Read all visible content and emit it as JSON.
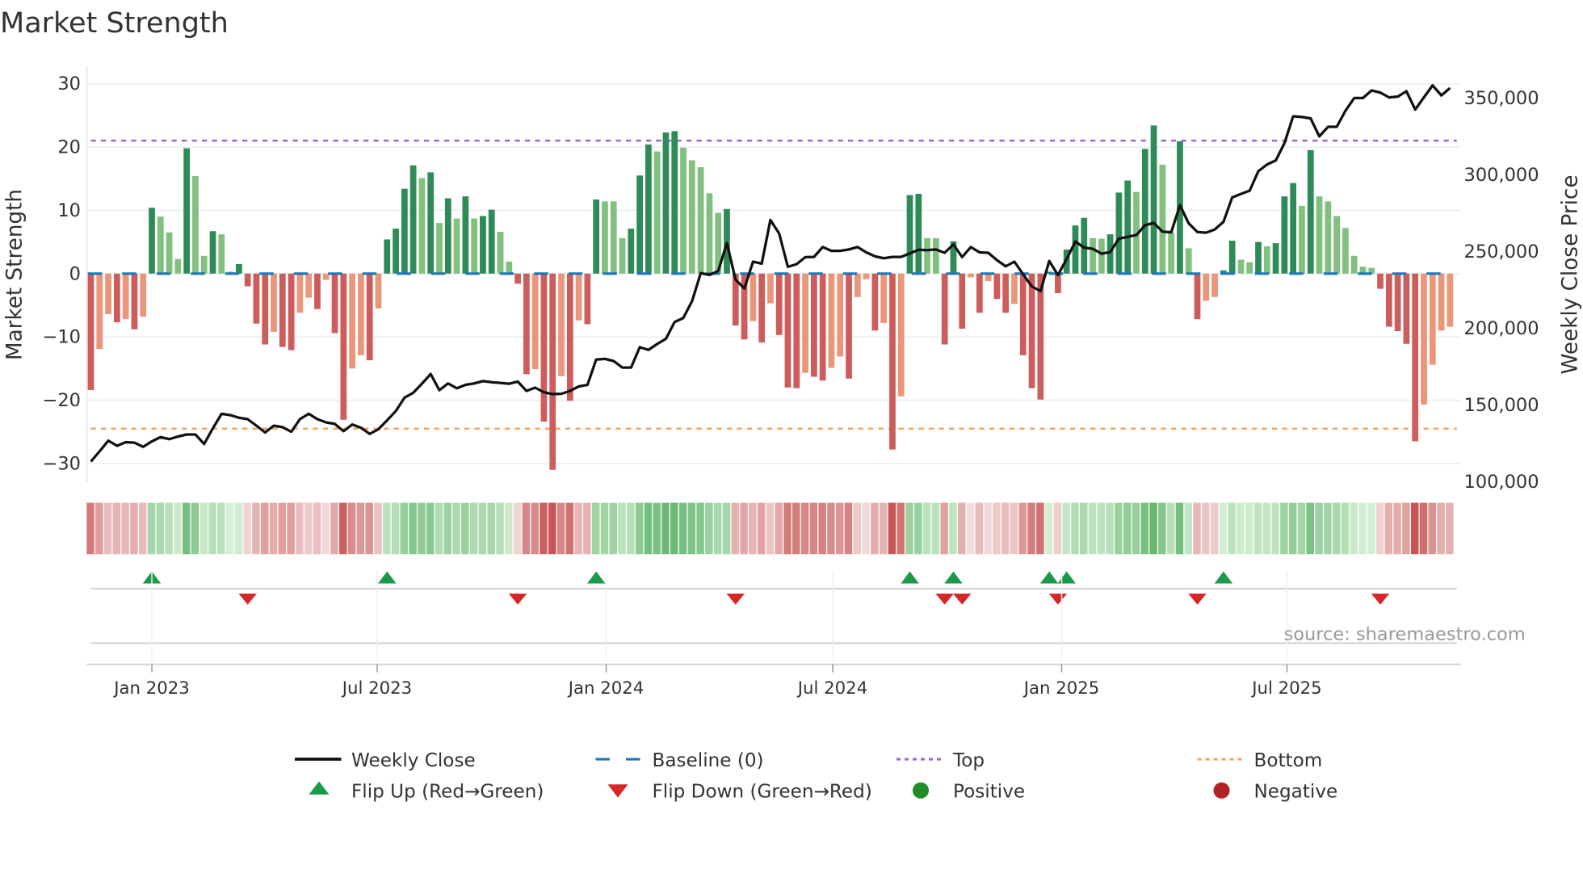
{
  "chart_data": {
    "type": "bar+line",
    "title": "Market Strength",
    "ylabel_left": "Market Strength",
    "ylabel_right": "Weekly Close Price",
    "ylim_left": [
      -33,
      31
    ],
    "ylim_right": [
      98000,
      362000
    ],
    "yticks_left": [
      30,
      20,
      10,
      0,
      -10,
      -20,
      -30
    ],
    "yticks_left_labels": [
      "30",
      "20",
      "10",
      "0",
      "−10",
      "−20",
      "−30"
    ],
    "yticks_right": [
      100000,
      150000,
      200000,
      250000,
      300000,
      350000
    ],
    "yticks_right_labels": [
      "100,000",
      "150,000",
      "200,000",
      "250,000",
      "300,000",
      "350,000"
    ],
    "xticks": [
      {
        "date": "2023-01-01",
        "label": "Jan 2023"
      },
      {
        "date": "2023-07-01",
        "label": "Jul 2023"
      },
      {
        "date": "2024-01-01",
        "label": "Jan 2024"
      },
      {
        "date": "2024-07-01",
        "label": "Jul 2024"
      },
      {
        "date": "2025-01-01",
        "label": "Jan 2025"
      },
      {
        "date": "2025-07-01",
        "label": "Jul 2025"
      }
    ],
    "start_date": "2022-11-13",
    "frequency": "weekly",
    "top_threshold": 21,
    "bottom_threshold": -24.5,
    "baseline": 0,
    "strength": [
      -18.4,
      -11.9,
      -6.4,
      -7.7,
      -7.2,
      -8.8,
      -6.8,
      10.4,
      9.0,
      6.5,
      2.3,
      19.8,
      15.4,
      2.8,
      6.7,
      6.2,
      0.3,
      1.5,
      -2.0,
      -7.9,
      -11.2,
      -9.2,
      -11.6,
      -12.1,
      -6.2,
      -3.8,
      -5.6,
      -1.0,
      -9.4,
      -23.1,
      -15.0,
      -12.9,
      -13.7,
      -5.5,
      5.4,
      7.1,
      13.4,
      17.1,
      15.1,
      16.0,
      8.0,
      11.9,
      8.7,
      12.2,
      8.7,
      9.1,
      10.1,
      6.6,
      1.9,
      -1.6,
      -15.9,
      -15.1,
      -23.4,
      -31.0,
      -16.2,
      -20.1,
      -7.4,
      -8.0,
      11.7,
      11.4,
      11.4,
      5.6,
      7.1,
      15.5,
      20.4,
      19.3,
      22.3,
      22.5,
      19.9,
      17.9,
      16.8,
      12.7,
      9.6,
      10.2,
      -8.2,
      -10.4,
      -7.5,
      -10.9,
      -4.7,
      -9.7,
      -18.0,
      -18.1,
      -15.7,
      -16.3,
      -16.9,
      -14.9,
      -13.1,
      -16.6,
      -3.7,
      -0.9,
      -9.0,
      -7.8,
      -27.8,
      -19.4,
      12.4,
      12.6,
      5.6,
      5.6,
      -11.2,
      5.1,
      -8.7,
      -0.6,
      -6.2,
      -1.2,
      -4.0,
      -6.2,
      -4.8,
      -12.9,
      -18.1,
      -19.9,
      0.3,
      -3.1,
      3.8,
      7.6,
      8.8,
      5.6,
      5.5,
      6.2,
      12.8,
      14.7,
      12.9,
      19.7,
      23.4,
      17.2,
      6.5,
      20.9,
      4.0,
      -7.2,
      -4.3,
      -3.7,
      0.5,
      5.2,
      2.2,
      1.8,
      5.0,
      4.3,
      4.8,
      12.2,
      14.3,
      10.7,
      19.5,
      12.2,
      11.4,
      9.1,
      7.2,
      2.8,
      1.1,
      0.9,
      -2.4,
      -8.4,
      -9.1,
      -11.1,
      -26.5,
      -20.7,
      -14.4,
      -9.0,
      -8.4
    ],
    "weekly_close": [
      112400,
      119000,
      126000,
      122600,
      125000,
      124700,
      122000,
      125500,
      128300,
      127000,
      128700,
      130000,
      130000,
      123800,
      134000,
      143500,
      142600,
      140900,
      140000,
      135700,
      131300,
      135700,
      134800,
      131800,
      140000,
      143500,
      140000,
      137900,
      136900,
      132200,
      136500,
      134400,
      130400,
      133400,
      139200,
      145300,
      154000,
      157200,
      163100,
      169400,
      158900,
      163300,
      160100,
      162400,
      163300,
      164800,
      164100,
      163600,
      163100,
      164500,
      158400,
      160500,
      157500,
      156300,
      156500,
      158400,
      161300,
      162400,
      178800,
      179300,
      177900,
      173600,
      173600,
      186900,
      185100,
      189000,
      192400,
      203300,
      205900,
      216900,
      235200,
      234000,
      236500,
      254800,
      230900,
      225100,
      242600,
      241400,
      269800,
      260900,
      239300,
      241000,
      245600,
      245700,
      252200,
      249700,
      249700,
      250600,
      252200,
      248700,
      246100,
      244900,
      245700,
      245700,
      248000,
      250400,
      250100,
      250600,
      248400,
      253900,
      245600,
      252200,
      248700,
      248400,
      243600,
      239600,
      242600,
      234400,
      226500,
      223400,
      243100,
      233900,
      244500,
      255700,
      251800,
      251000,
      247800,
      248900,
      257600,
      258800,
      260000,
      266300,
      267900,
      262200,
      261800,
      279400,
      267600,
      262000,
      261500,
      263600,
      268600,
      284500,
      286800,
      288900,
      301600,
      306000,
      308600,
      319900,
      337400,
      336900,
      336000,
      324300,
      330500,
      330500,
      341000,
      349300,
      349300,
      354200,
      352800,
      349700,
      350200,
      353700,
      341800,
      349700,
      357500,
      351000,
      355800
    ],
    "legend": {
      "position": "bottom",
      "items": [
        {
          "key": "close",
          "label": "Weekly Close"
        },
        {
          "key": "baseline",
          "label": "Baseline (0)"
        },
        {
          "key": "top",
          "label": "Top"
        },
        {
          "key": "bottom",
          "label": "Bottom"
        },
        {
          "key": "flip_up",
          "label": "Flip Up (Red→Green)"
        },
        {
          "key": "flip_down",
          "label": "Flip Down (Green→Red)"
        },
        {
          "key": "positive",
          "label": "Positive"
        },
        {
          "key": "negative",
          "label": "Negative"
        }
      ]
    },
    "annotation": "source: sharemaestro.com"
  },
  "colors": {
    "green_strong": "#2e8b57",
    "green_weak": "#81c07f",
    "red_strong": "#cd5c5c",
    "red_weak": "#e9967a",
    "baseline": "#1f77b4",
    "top": "#9966dd",
    "bottom": "#f4a460",
    "flip_up": "#1a9a4a",
    "flip_down": "#d62728",
    "positive": "#228b22",
    "negative": "#b22222",
    "line": "#111111"
  }
}
